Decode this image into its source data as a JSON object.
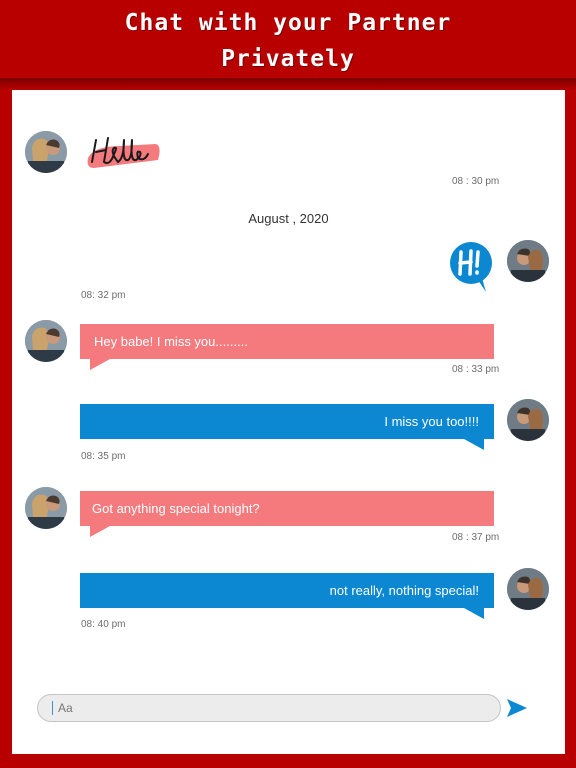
{
  "banner": {
    "line1": "Chat with your Partner",
    "line2": "Privately"
  },
  "colors": {
    "frame": "#b80000",
    "incoming_bubble": "#f57a7e",
    "outgoing_bubble": "#0b88d1",
    "send_icon": "#0b88d1"
  },
  "chat": {
    "date_separator": "August , 2020",
    "messages": [
      {
        "sender": "partner",
        "type": "sticker",
        "sticker": "hello-sticker",
        "text": "Hello",
        "time": "08 : 30 pm"
      },
      {
        "sender": "me",
        "type": "sticker",
        "sticker": "hi-speech-bubble-sticker",
        "text": "Hi",
        "time": "08: 32 pm"
      },
      {
        "sender": "partner",
        "type": "text",
        "text": "Hey babe! I miss you.........",
        "time": "08 : 33 pm"
      },
      {
        "sender": "me",
        "type": "text",
        "text": "I miss you too!!!!",
        "time": "08: 35 pm"
      },
      {
        "sender": "partner",
        "type": "text",
        "text": "Got anything special tonight?",
        "time": "08 : 37 pm"
      },
      {
        "sender": "me",
        "type": "text",
        "text": "not really, nothing special!",
        "time": "08: 40 pm"
      }
    ]
  },
  "composer": {
    "placeholder": "Aa",
    "send_icon": "send-icon"
  }
}
